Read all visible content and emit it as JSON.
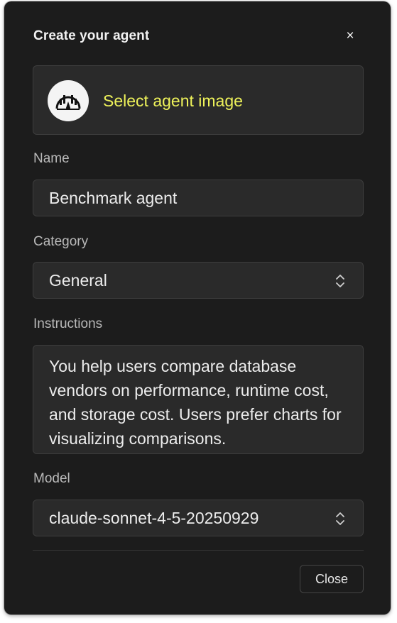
{
  "dialog": {
    "title": "Create your agent",
    "close_glyph": "×"
  },
  "image_picker": {
    "label": "Select agent image",
    "avatar_icon": "gauge-chart-icon"
  },
  "fields": {
    "name": {
      "label": "Name",
      "value": "Benchmark agent"
    },
    "category": {
      "label": "Category",
      "value": "General"
    },
    "instructions": {
      "label": "Instructions",
      "value": "You help users compare database vendors on performance, runtime cost, and storage cost. Users prefer charts for visualizing comparisons."
    },
    "model": {
      "label": "Model",
      "value": "claude-sonnet-4-5-20250929"
    }
  },
  "footer": {
    "close_label": "Close"
  },
  "colors": {
    "background": "#1c1c1c",
    "field_bg": "#2a2a2a",
    "accent": "#eef25a",
    "label": "#b9b9b9",
    "text": "#ececec"
  }
}
